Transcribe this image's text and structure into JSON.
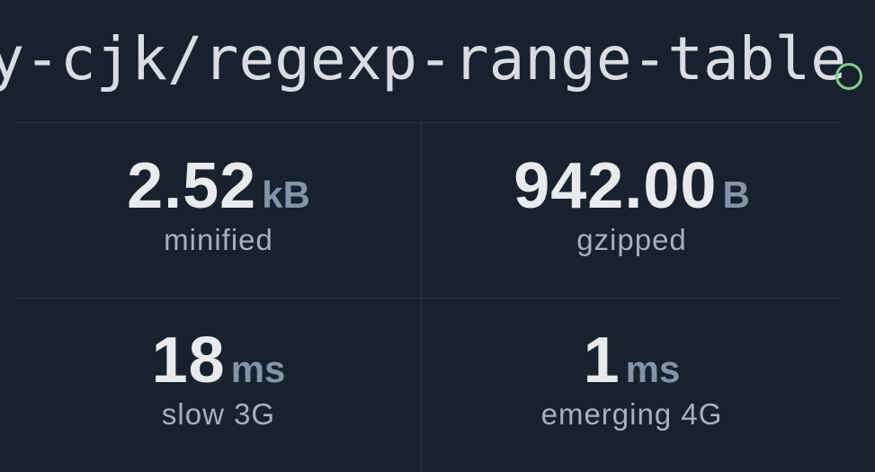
{
  "package": {
    "name": "y-cjk/regexp-range-table"
  },
  "colors": {
    "background": "#18222e",
    "value": "#e8eaed",
    "unit": "#8593a6",
    "label": "#a7b0bc",
    "version_badge": "#7fd089"
  },
  "stats": {
    "minified": {
      "value": "2.52",
      "unit": "kB",
      "label": "minified"
    },
    "gzipped": {
      "value": "942.00",
      "unit": "B",
      "label": "gzipped"
    },
    "slow3g": {
      "value": "18",
      "unit": "ms",
      "label": "slow 3G"
    },
    "emerging4g": {
      "value": "1",
      "unit": "ms",
      "label": "emerging 4G"
    }
  }
}
